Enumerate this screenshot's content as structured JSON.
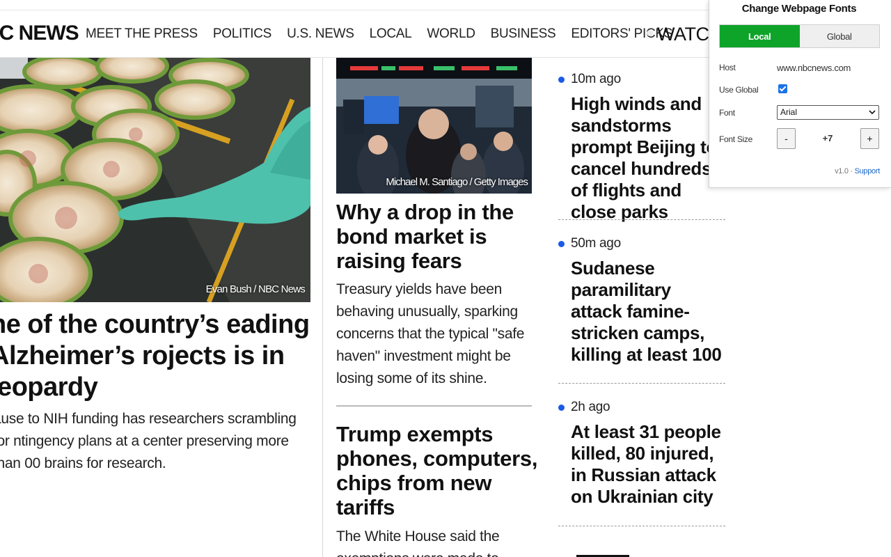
{
  "nav": {
    "logo": "BC NEWS",
    "items": [
      "MEET THE PRESS",
      "POLITICS",
      "U.S. NEWS",
      "LOCAL",
      "WORLD",
      "BUSINESS",
      "EDITORS' PICKS"
    ],
    "watch": "WATCH"
  },
  "lead": {
    "credit": "Evan Bush / NBC News",
    "headline": "ne of the country’s eading Alzheimer’s rojects is in jeopardy",
    "dek": "ause to NIH funding has researchers scrambling for ntingency plans at a center preserving more than 00 brains for research."
  },
  "middle": {
    "credit": "Michael M. Santiago / Getty Images",
    "headline": "Why a drop in the bond market is raising fears",
    "dek": "Treasury yields have been behaving unusually, sparking concerns that the typical \"safe haven\" investment might be losing some of its shine.",
    "headline2": "Trump exempts phones, computers, chips from new tariffs",
    "dek2": "The White House said the exemptions were made to"
  },
  "latest": [
    {
      "time": "10m ago",
      "title": "High winds and sandstorms prompt Beijing to cancel hundreds of flights and close parks"
    },
    {
      "time": "50m ago",
      "title": "Sudanese paramilitary attack famine-stricken camps, killing at least 100"
    },
    {
      "time": "2h ago",
      "title": "At least 31 people killed, 80 injured, in Russian attack on Ukrainian city"
    }
  ],
  "popup": {
    "title": "Change Webpage Fonts",
    "tab_local": "Local",
    "tab_global": "Global",
    "host_label": "Host",
    "host_value": "www.nbcnews.com",
    "use_global_label": "Use Global",
    "use_global_checked": true,
    "font_label": "Font",
    "font_value": "Arial",
    "font_size_label": "Font Size",
    "minus": "-",
    "plus": "+",
    "font_size_value": "+7",
    "version": "v1.0 · ",
    "support": "Support"
  },
  "colors": {
    "accent_green": "#0ea42a",
    "latest_dot": "#1a5ae8",
    "link_blue": "#1a66c8"
  }
}
